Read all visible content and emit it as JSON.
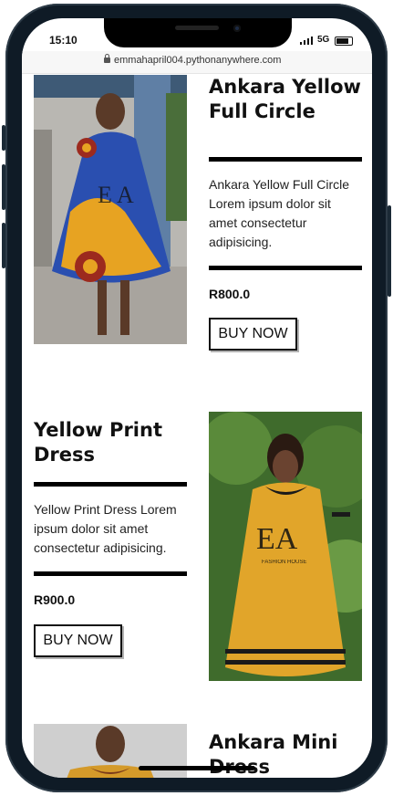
{
  "status_bar": {
    "time": "15:10",
    "network": "5G"
  },
  "browser": {
    "url": "emmahapril004.pythonanywhere.com"
  },
  "products": [
    {
      "title_line1": "Ankara Yellow",
      "title_line2": "Full Circle",
      "desc_line1": "Ankara Yellow Full Circle",
      "desc_line2": "Lorem ipsum dolor sit",
      "desc_line3": "amet consectetur",
      "desc_line4": "adipisicing.",
      "price": "R800.0",
      "button": "BUY NOW"
    },
    {
      "title_line1": "Yellow Print",
      "title_line2": "Dress",
      "desc_line1": "Yellow Print Dress Lorem",
      "desc_line2": "ipsum dolor sit amet",
      "desc_line3": "consectetur adipisicing.",
      "price": "R900.0",
      "button": "BUY NOW"
    },
    {
      "title_line1": "Ankara Mini",
      "title_line2": "Dress"
    }
  ],
  "watermark": {
    "letters": "EA",
    "sub": "FASHION HOUSE"
  }
}
